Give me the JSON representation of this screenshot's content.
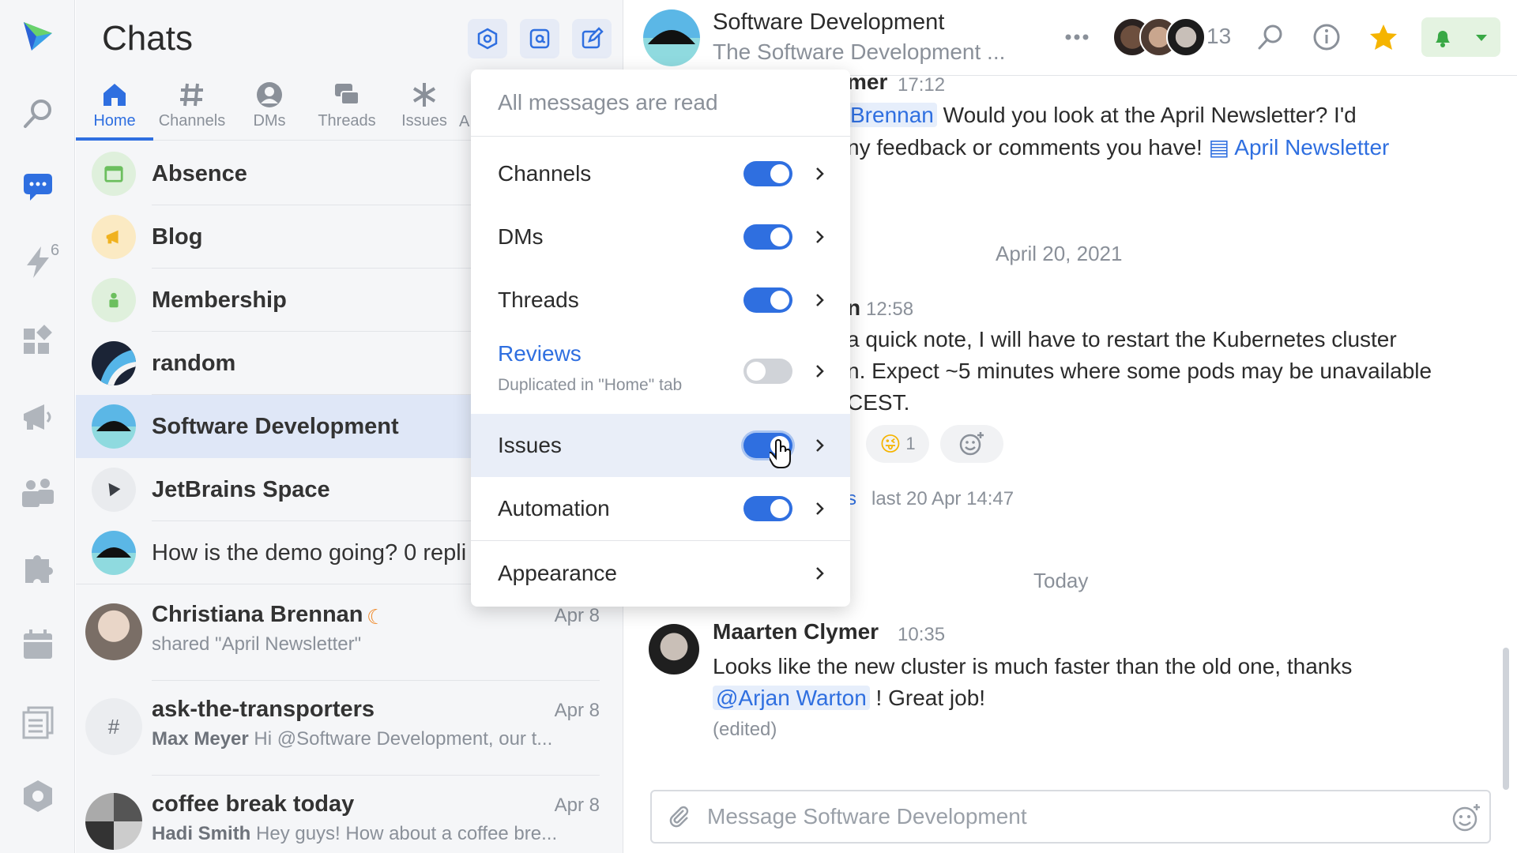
{
  "rail": {
    "badge": "6"
  },
  "panel": {
    "title": "Chats",
    "tabs": [
      "Home",
      "Channels",
      "DMs",
      "Threads",
      "Issues",
      "A"
    ],
    "channels": [
      {
        "name": "Absence",
        "color": "#dff0dc"
      },
      {
        "name": "Blog",
        "color": "#fbeac3"
      },
      {
        "name": "Membership",
        "color": "#dff0dc"
      },
      {
        "name": "random"
      },
      {
        "name": "Software Development"
      },
      {
        "name": "JetBrains Space"
      },
      {
        "name": "How is the demo going? 0 repli"
      }
    ],
    "dms": [
      {
        "name": "Christiana Brennan",
        "date": "Apr 8",
        "sub_author": "",
        "sub": "shared \"April Newsletter\""
      },
      {
        "name": "ask-the-transporters",
        "date": "Apr 8",
        "sub_author": "Max Meyer",
        "sub": " Hi @Software Development, our t..."
      },
      {
        "name": "coffee break today",
        "date": "Apr 8",
        "sub_author": "Hadi Smith",
        "sub": " Hey guys! How about a coffee bre..."
      }
    ]
  },
  "main": {
    "title": "Software Development",
    "subtitle": "The Software Development ...",
    "member_count": "13",
    "msg1": {
      "author_tail": "mer",
      "time": "17:12",
      "mention": "Brennan",
      "line1_rest": " Would you look at the April Newsletter? I'd",
      "line2": "ny feedback or comments you have!",
      "link": "April Newsletter"
    },
    "date1": "April 20, 2021",
    "msg2": {
      "author_tail": "n",
      "time": "12:58",
      "line1": "a quick note, I will have to restart the Kubernetes cluster",
      "line2": "n. Expect ~5 minutes where some pods may be unavailable",
      "line3": "CEST."
    },
    "reaction_count": "1",
    "thread_tail": "s",
    "thread_meta": "last 20 Apr 14:47",
    "date2": "Today",
    "msg3": {
      "author": "Maarten Clymer",
      "time": "10:35",
      "line1": "Looks like the new cluster is much faster than the old one, thanks",
      "mention": "@Arjan Warton",
      "line2_rest": " ! Great job!",
      "edited": "(edited)"
    },
    "composer_placeholder": "Message Software Development"
  },
  "menu": {
    "header": "All messages are read",
    "items": [
      {
        "label": "Channels",
        "on": true
      },
      {
        "label": "DMs",
        "on": true
      },
      {
        "label": "Threads",
        "on": true
      },
      {
        "label": "Reviews",
        "note": "Duplicated in \"Home\" tab",
        "on": false
      },
      {
        "label": "Issues",
        "on": true
      },
      {
        "label": "Automation",
        "on": true
      }
    ],
    "appearance": "Appearance"
  },
  "colors": {
    "accent": "#2f6fe0",
    "star": "#f5b400",
    "bell": "#39a845"
  }
}
